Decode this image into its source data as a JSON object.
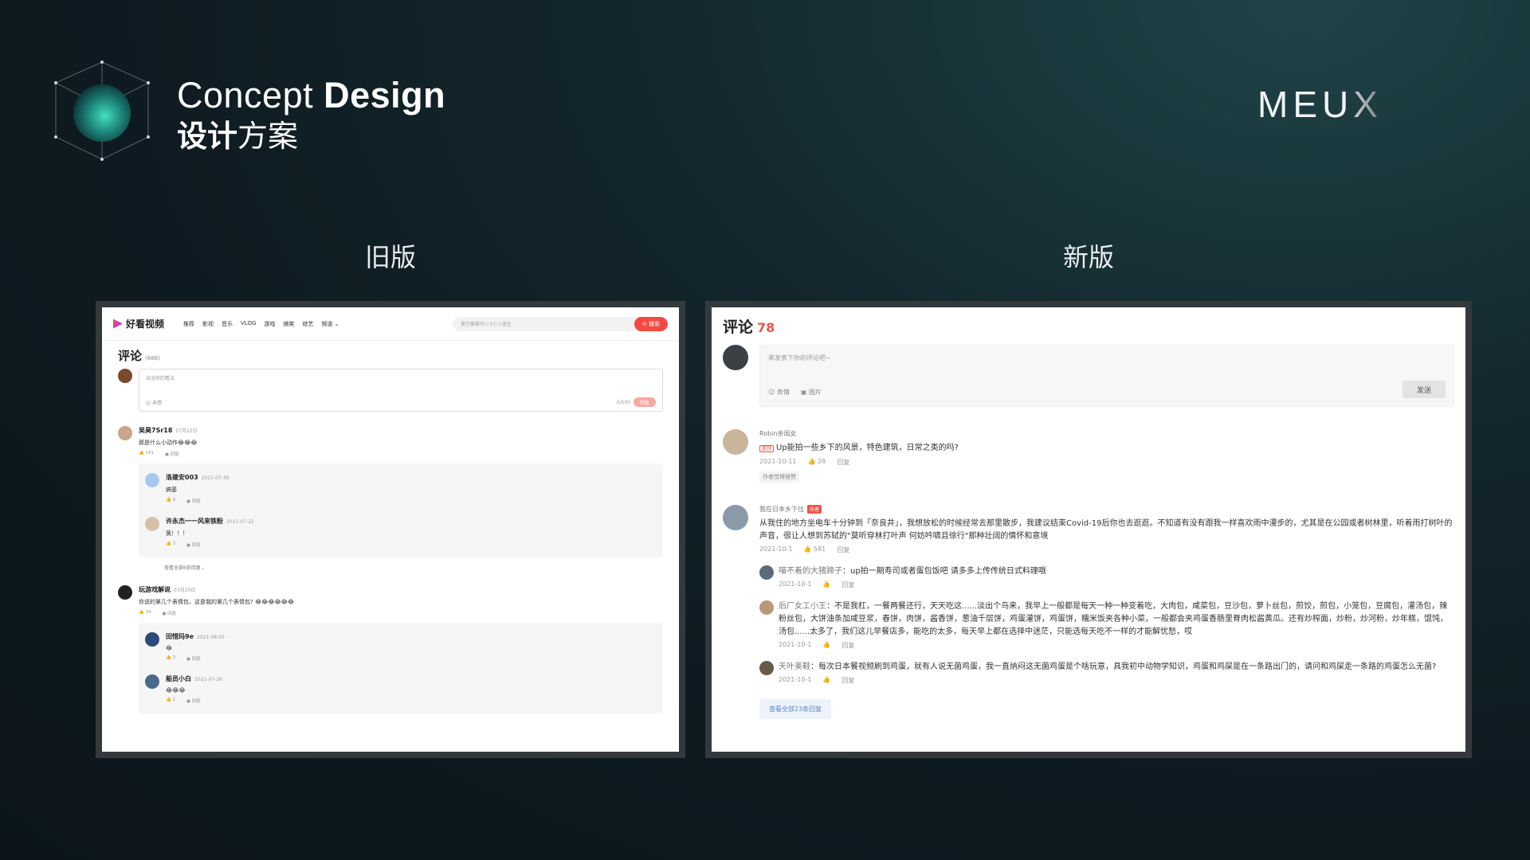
{
  "header": {
    "title_en_light": "Concept ",
    "title_en_bold": "Design",
    "title_cn_bold": "设计",
    "title_cn_light": "方案",
    "brand_main": "MEU",
    "brand_x": "X"
  },
  "labels": {
    "old": "旧版",
    "new": "新版"
  },
  "old": {
    "brand": "好看视频",
    "nav": [
      "推荐",
      "影视",
      "音乐",
      "VLOG",
      "游戏",
      "搞笑",
      "综艺",
      "频道 ⌄"
    ],
    "search_placeholder": "黄空雕雕布少3小人搜生",
    "search_button": "⊙ 搜索",
    "comments_title": "评论",
    "comments_count": "(666)",
    "input_placeholder": "说说你的看法",
    "emoji_label": "☺ 表情",
    "char_count": "0/500",
    "send": "回复",
    "comments": [
      {
        "name": "吴昊7Sr18",
        "date": "07月22日",
        "text": "那是什么小动作😂😂😂",
        "likes": "👍 181",
        "reply": "● 回复",
        "replies": [
          {
            "name": "洛建安003",
            "date": "2021-07-30",
            "text": "搞基",
            "likes": "👍 9",
            "reply": "● 回复"
          },
          {
            "name": "许永杰一一风来铁粉",
            "date": "2021-07-22",
            "text": "黄！！！",
            "likes": "👍 3",
            "reply": "● 回复"
          }
        ],
        "more": "查看全部6条回复⌄"
      },
      {
        "name": "玩游戏解说",
        "date": "07月20日",
        "text": "你说的第几个表情包，这是我的第几个表情包? 😂😂😂😂😂😂",
        "likes": "👍 34",
        "reply": "● 回复",
        "replies": [
          {
            "name": "田惜玛9e",
            "date": "2021-08-03",
            "text": "😂",
            "likes": "👍 3",
            "reply": "● 回复"
          },
          {
            "name": "船员小白",
            "date": "2021-07-26",
            "text": "😂😂😂",
            "likes": "👍 2",
            "reply": "● 回复"
          }
        ]
      }
    ]
  },
  "new": {
    "comments_title": "评论",
    "comments_count": "78",
    "input_placeholder": "来发表下你的评论吧~",
    "emoji_label": "☺ 表情",
    "image_label": "▣ 图片",
    "send": "发送",
    "c1": {
      "name": "Robin亲闺女",
      "tag": "置顶",
      "text": "Up能拍一些乡下的风景，特色建筑，日常之类的吗?",
      "date": "2021-10-11",
      "likes": "28",
      "reply": "回复",
      "chip": "作者觉得很赞"
    },
    "c2": {
      "name": "我在日本乡下住",
      "tag": "作者",
      "text": "从我住的地方坐电车十分钟到「奈良井」，我想放松的时候经常去那里散步，我建议结束Covid-19后你也去逛逛。不知道有没有跟我一样喜欢雨中漫步的，尤其是在公园或者树林里，听着雨打树叶的声音，很让人想到苏轼的\"莫听穿林打叶声  何妨吟啸且徐行\"那种壮阔的情怀和意境",
      "date": "2021-10-1",
      "likes": "581",
      "reply": "回复",
      "replies": [
        {
          "name": "喵不着的大猪蹄子",
          "text": "up拍一期寿司或者蛋包饭吧 请多多上传传统日式料理哦",
          "date": "2021-10-1",
          "reply": "回复"
        },
        {
          "name": "后厂女工小王",
          "text": "不是我杠，一餐两餐还行，天天吃这......淡出个鸟来，我早上一般都是每天一种一种变着吃，大肉包，咸菜包，豆沙包，萝卜丝包，煎饺，煎包，小笼包，豆腐包，灌汤包，辣粉丝包，大饼油条加咸豆浆，春饼，肉饼，酱香饼，葱油千层饼，鸡蛋灌饼，鸡蛋饼，糯米饭夹各种小菜，一般都会夹鸡蛋香肠里脊肉松酱黄瓜。还有炒榨面，炒粉，炒河粉，炒年糕，馄饨，汤包......太多了，我们这儿早餐店多，能吃的太多，每天早上都在选择中迷茫，只能选每天吃不一样的才能解忧愁，哎",
          "date": "2021-10-1",
          "reply": "回复"
        },
        {
          "name": "天叶美鞋",
          "text": "每次日本餐视频刷到鸡蛋，就有人说无菌鸡蛋，我一直纳闷这无菌鸡蛋是个啥玩意，具我初中动物学知识，鸡蛋和鸡屎是在一条路出门的，请问和鸡屎走一条路的鸡蛋怎么无菌?",
          "date": "2021-10-1",
          "reply": "回复"
        }
      ],
      "view_all": "查看全部23条回复"
    }
  }
}
